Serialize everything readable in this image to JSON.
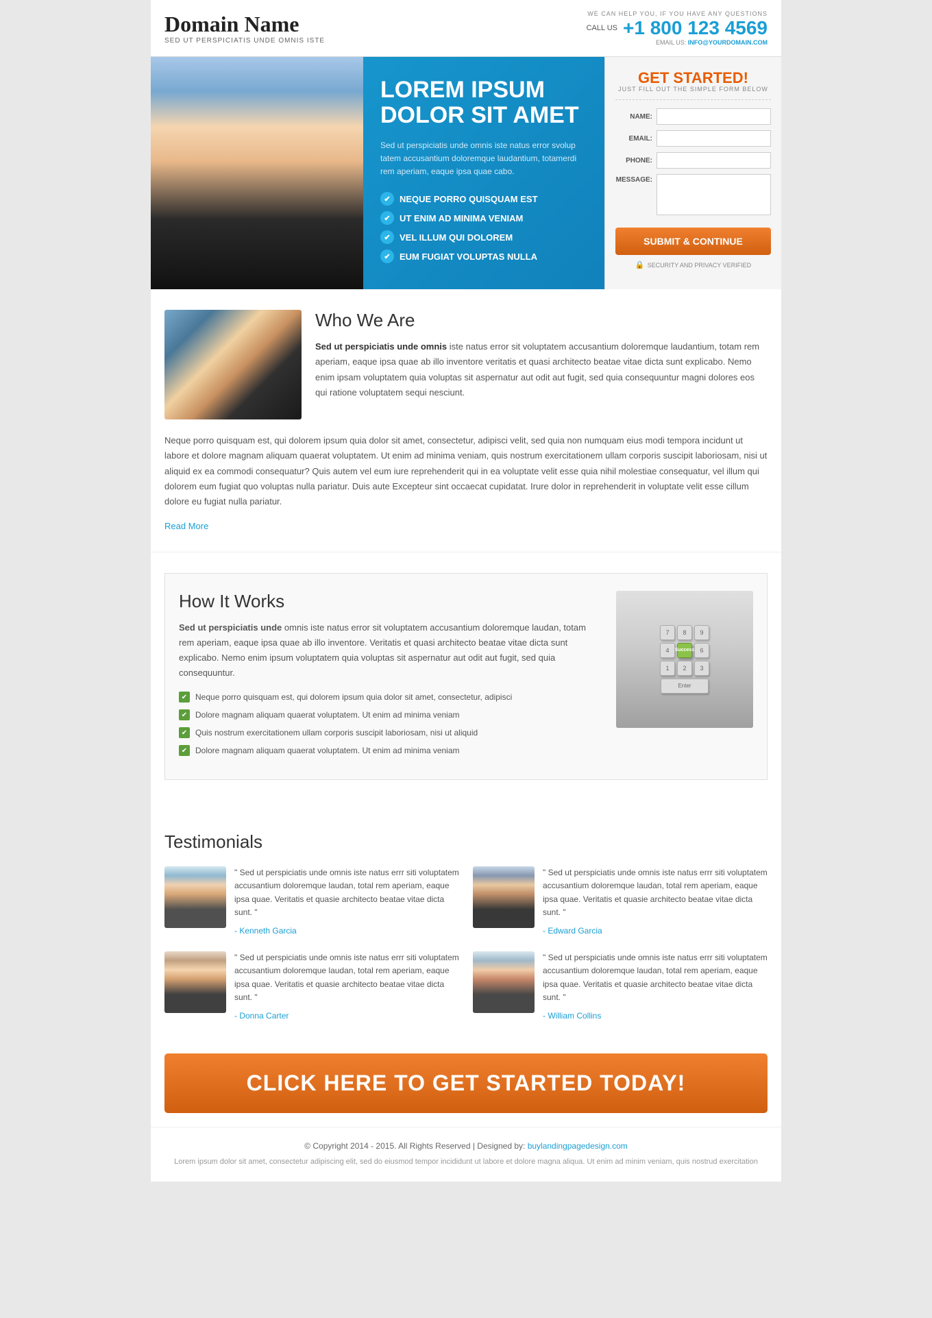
{
  "header": {
    "domain_name": "Domain Name",
    "tagline": "SED UT PERSPICIATIS UNDE OMNIS ISTE",
    "we_can_help": "WE CAN HELP YOU, IF YOU HAVE ANY QUESTIONS",
    "call_us_label": "CALL US",
    "phone": "+1 800 123 4569",
    "email_label": "EMAIL US:",
    "email": "info@yourdomain.com"
  },
  "hero": {
    "heading_line1": "LOREM IPSUM",
    "heading_line2": "DOLOR SIT AMET",
    "description": "Sed ut perspiciatis unde omnis iste natus error svolup tatem accusantium doloremque laudantium, totamerdi rem aperiam, eaque ipsa quae cabo.",
    "checklist": [
      "NEQUE PORRO QUISQUAM EST",
      "UT ENIM AD MINIMA VENIAM",
      "VEL ILLUM QUI DOLOREM",
      "EUM FUGIAT VOLUPTAS NULLA"
    ]
  },
  "form": {
    "title": "GET STARTED!",
    "subtitle": "JUST FILL OUT THE SIMPLE FORM BELOW",
    "name_label": "NAME:",
    "email_label": "EMAIL:",
    "phone_label": "PHONE:",
    "message_label": "MESSAGE:",
    "submit_button": "SUBMIT & CONTINUE",
    "security_text": "SECURITY AND PRIVACY VERIFIED"
  },
  "who_we_are": {
    "heading": "Who We Are",
    "para1_bold": "Sed ut perspiciatis unde omnis",
    "para1": " iste natus error sit voluptatem accusantium doloremque laudantium, totam rem aperiam, eaque ipsa quae ab illo inventore veritatis et quasi architecto beatae vitae dicta sunt explicabo. Nemo enim ipsam voluptatem quia voluptas sit aspernatur aut odit aut fugit, sed quia consequuntur magni dolores eos qui ratione voluptatem sequi nesciunt.",
    "para2": "Neque porro quisquam est, qui dolorem ipsum quia dolor sit amet, consectetur, adipisci velit, sed quia non numquam eius modi tempora incidunt ut labore et dolore magnam aliquam quaerat voluptatem. Ut enim ad minima veniam, quis nostrum exercitationem ullam corporis suscipit laboriosam, nisi ut aliquid ex ea commodi consequatur? Quis autem vel eum iure reprehenderit qui in ea voluptate velit esse quia nihil molestiae consequatur, vel illum qui dolorem eum fugiat quo voluptas nulla pariatur. Duis aute Excepteur sint occaecat cupidatat. Irure dolor in reprehenderit in voluptate velit esse cillum dolore eu fugiat nulla pariatur.",
    "link1": "voluptatem quia voluptas",
    "link2": "suscipit laboriosam",
    "read_more": "Read More"
  },
  "how_it_works": {
    "heading": "How It Works",
    "para_bold": "Sed ut perspiciatis unde",
    "para": " omnis iste natus error sit voluptatem accusantium doloremque laudan, totam rem aperiam, eaque ipsa quae ab illo inventore. Veritatis et quasi architecto beatae vitae dicta sunt explicabo. Nemo enim ipsum voluptatem quia voluptas sit aspernatur aut odit aut fugit, sed quia consequuntur.",
    "list": [
      "Neque porro quisquam est, qui dolorem ipsum quia dolor sit amet, consectetur, adipisci",
      "Dolore magnam aliquam quaerat voluptatem. Ut enim ad minima veniam",
      "Quis nostrum exercitationem ullam corporis suscipit laboriosam, nisi ut aliquid",
      "Dolore magnam aliquam quaerat voluptatem. Ut enim ad minima veniam"
    ],
    "link": "Nemo enim ipsum voluptatem",
    "success_label": "Success"
  },
  "testimonials": {
    "heading": "Testimonials",
    "items": [
      {
        "quote": "\" Sed ut perspiciatis unde omnis iste natus errr siti voluptatem accusantium doloremque laudan, total rem aperiam, eaque ipsa quae. Veritatis et quasie architecto beatae vitae dicta sunt. \"",
        "author": "- Kenneth Garcia"
      },
      {
        "quote": "\" Sed ut perspiciatis unde omnis iste natus errr siti voluptatem accusantium doloremque laudan, total rem aperiam, eaque ipsa quae. Veritatis et quasie architecto beatae vitae dicta sunt. \"",
        "author": "- Edward Garcia"
      },
      {
        "quote": "\" Sed ut perspiciatis unde omnis iste natus errr siti voluptatem accusantium doloremque laudan, total rem aperiam, eaque ipsa quae. Veritatis et quasie architecto beatae vitae dicta sunt. \"",
        "author": "- Donna Carter"
      },
      {
        "quote": "\" Sed ut perspiciatis unde omnis iste natus errr siti voluptatem accusantium doloremque laudan, total rem aperiam, eaque ipsa quae. Veritatis et quasie architecto beatae vitae dicta sunt. \"",
        "author": "- William Collins"
      }
    ]
  },
  "cta": {
    "text": "CLICK HERE TO GET STARTED TODAY!"
  },
  "footer": {
    "copyright": "© Copyright 2014 - 2015. All Rights Reserved | Designed by:",
    "designer_link": "buylandingpagedesign.com",
    "desc": "Lorem ipsum dolor sit amet, consectetur adipiscing elit, sed do eiusmod tempor incididunt ut labore et dolore magna aliqua. Ut enim ad minim veniam, quis nostrud exercitation"
  }
}
